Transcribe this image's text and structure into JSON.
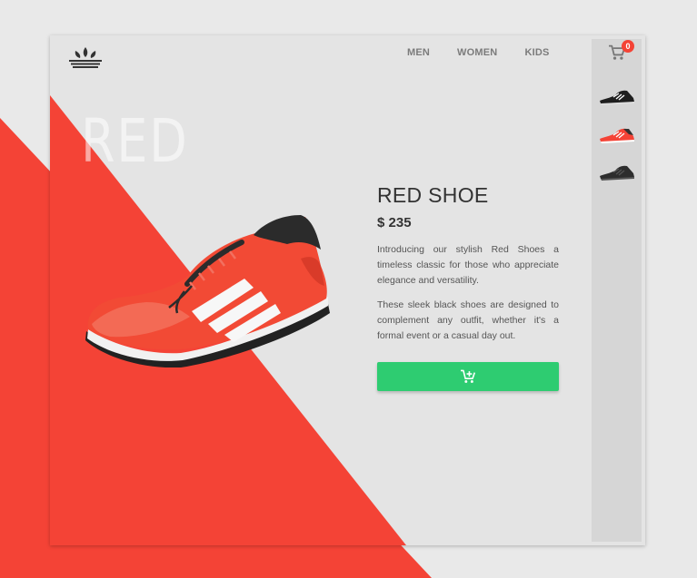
{
  "brand": {
    "logo_icon": "adidas-trefoil-logo"
  },
  "nav": {
    "items": [
      "MEN",
      "WOMEN",
      "KIDS"
    ]
  },
  "cart": {
    "count": "0",
    "icon": "cart-icon"
  },
  "thumbnails": [
    {
      "name": "black-shoe-thumbnail",
      "color": "#222222"
    },
    {
      "name": "red-shoe-thumbnail",
      "color": "#f44336"
    },
    {
      "name": "dark-grey-shoe-thumbnail",
      "color": "#333333"
    }
  ],
  "hero": {
    "word": "RED"
  },
  "product": {
    "title": "RED SHOE",
    "price": "$ 235",
    "description_1": "Introducing our stylish Red Shoes a timeless classic for those who appreciate elegance and versatility.",
    "description_2": "These sleek black shoes are designed to complement any outfit, whether it's a formal event or a casual day out.",
    "add_to_cart_icon": "add-to-cart-icon"
  },
  "colors": {
    "accent_red": "#f44336",
    "button_green": "#2ecc71"
  }
}
